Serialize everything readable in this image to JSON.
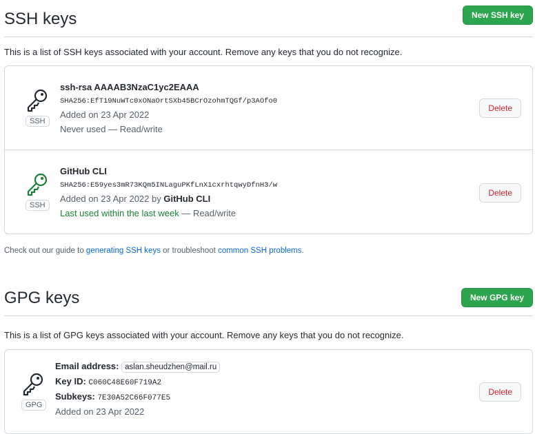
{
  "ssh": {
    "title": "SSH keys",
    "new_button": "New SSH key",
    "description": "This is a list of SSH keys associated with your account. Remove any keys that you do not recognize.",
    "keys": [
      {
        "title": "ssh-rsa AAAAB3NzaC1yc2EAAA",
        "fingerprint": "SHA256:EfT19NuWTc0xONaOrtSXb45BCrOzohmTQGf/p3AOfo0",
        "added": "Added on 23 Apr 2022",
        "usage": "Never used",
        "access": " — Read/write",
        "badge": "SSH",
        "icon_color": "#24292f",
        "delete_label": "Delete"
      },
      {
        "title": "GitHub CLI",
        "fingerprint": "SHA256:E59yes3mR73KQm5INLaguPKfLnX1cxrhtqwyDfnH3/w",
        "added": "Added on 23 Apr 2022 by ",
        "added_by": "GitHub CLI",
        "usage": "Last used within the last week",
        "access": " — Read/write",
        "badge": "SSH",
        "icon_color": "#1a7f37",
        "delete_label": "Delete"
      }
    ],
    "guide": {
      "prefix": "Check out our guide to ",
      "link1": "generating SSH keys",
      "middle": " or troubleshoot ",
      "link2": "common SSH problems",
      "suffix": "."
    }
  },
  "gpg": {
    "title": "GPG keys",
    "new_button": "New GPG key",
    "description": "This is a list of GPG keys associated with your account. Remove any keys that you do not recognize.",
    "key": {
      "email_label": "Email address:",
      "email": "aslan.sheudzhen@mail.ru",
      "key_id_label": "Key ID:",
      "key_id": "C060C48E60F719A2",
      "subkeys_label": "Subkeys:",
      "subkeys": "7E30A52C66F077E5",
      "added": "Added on 23 Apr 2022",
      "badge": "GPG",
      "icon_color": "#24292f",
      "delete_label": "Delete"
    }
  }
}
